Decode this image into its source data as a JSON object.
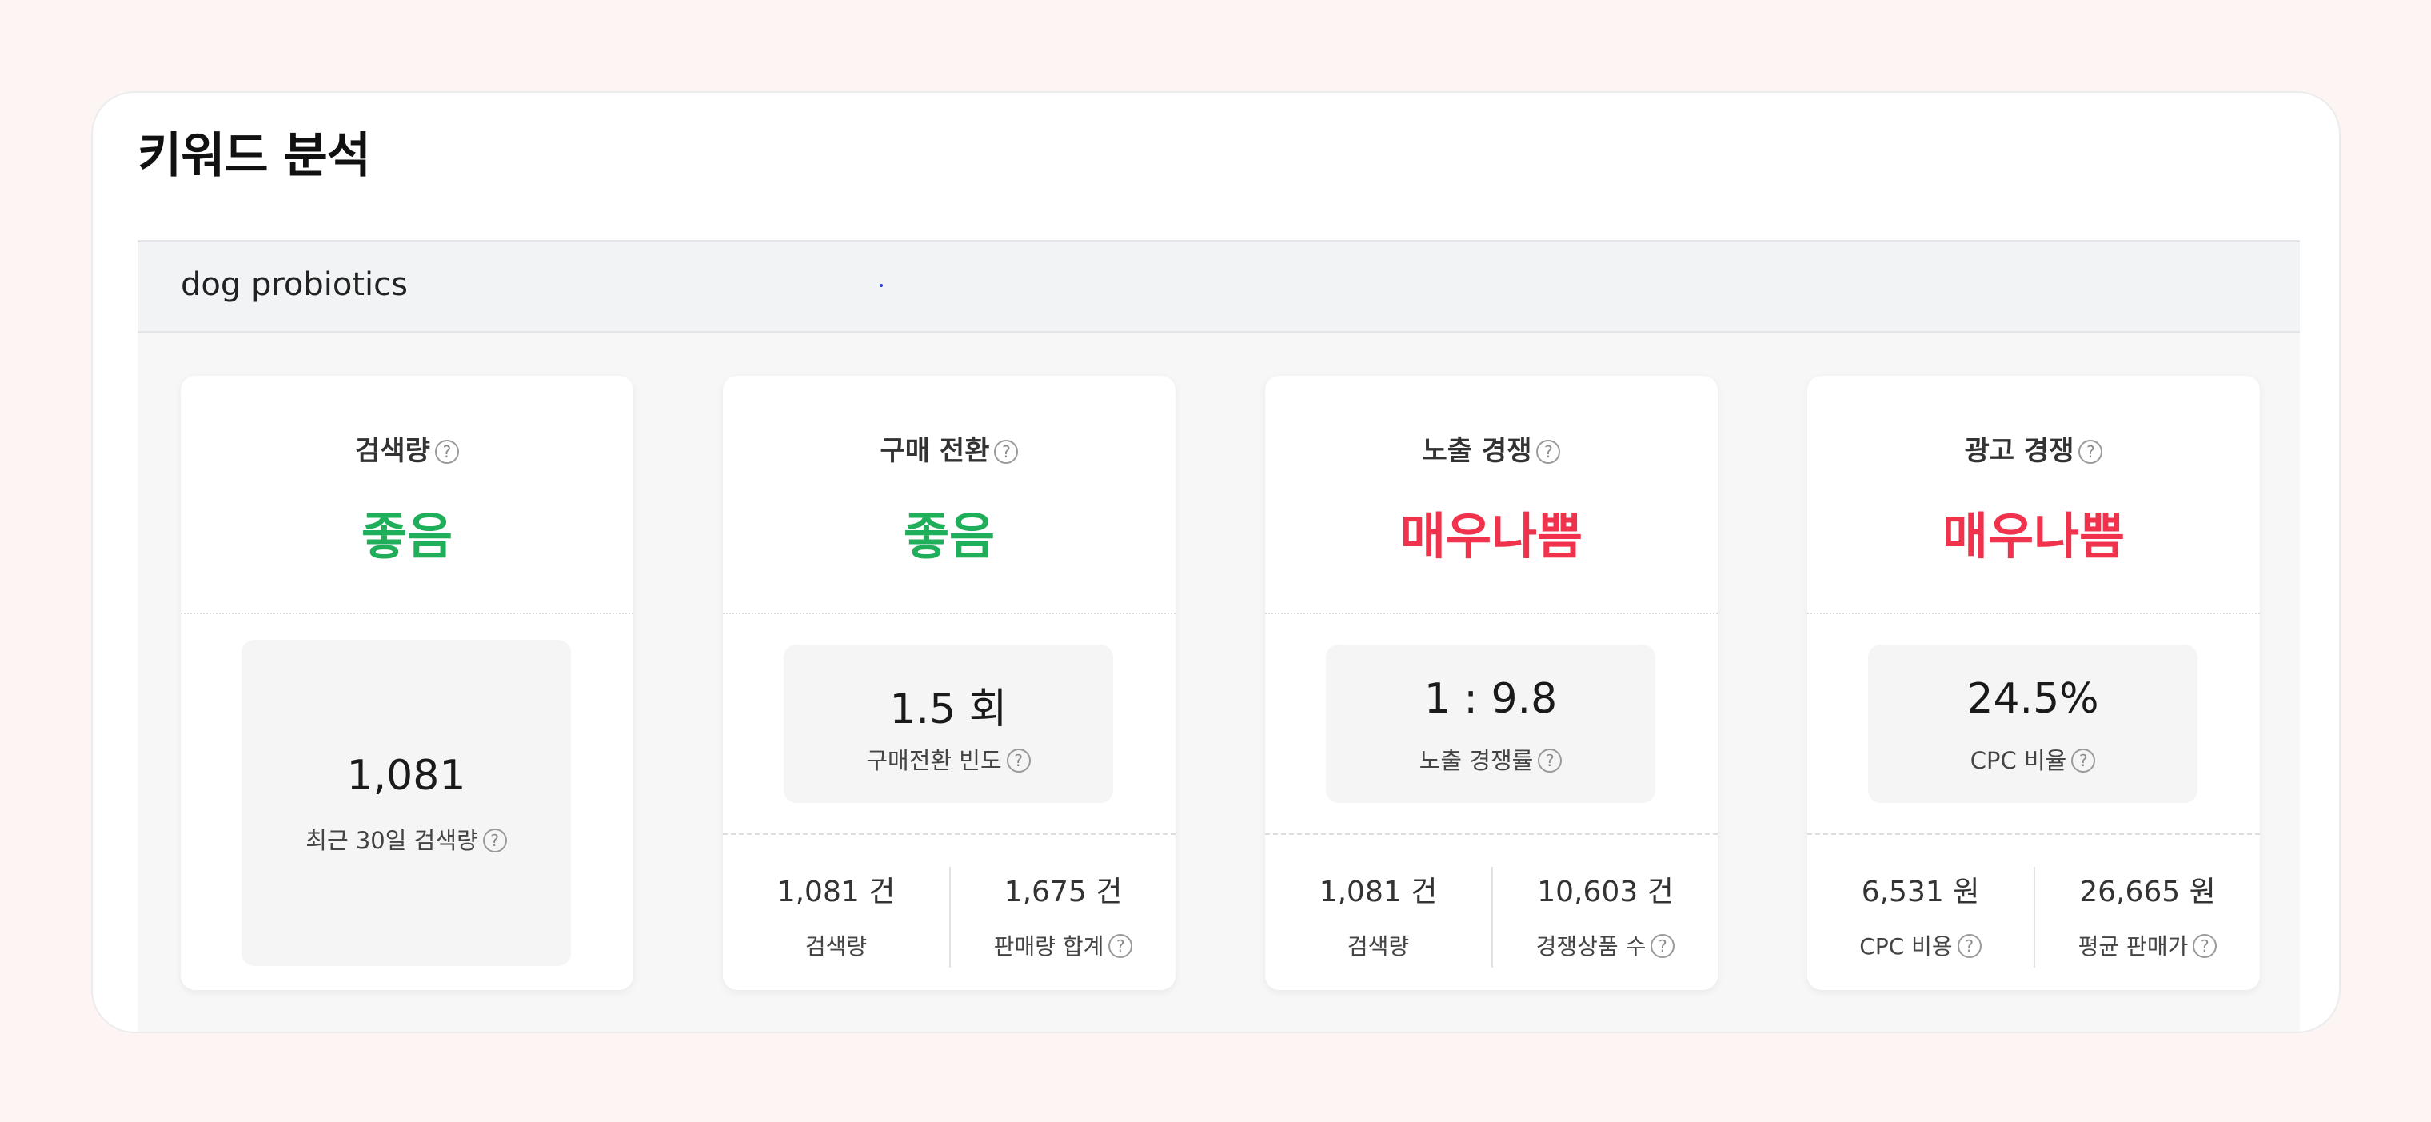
{
  "title": "키워드 분석",
  "keyword": "dog probiotics",
  "help_glyph": "?",
  "colors": {
    "good": "#1fae5a",
    "bad": "#f0324d"
  },
  "cards": [
    {
      "label": "검색량",
      "status": "좋음",
      "status_type": "good",
      "metric_value": "1,081",
      "metric_caption": "최근 30일 검색량"
    },
    {
      "label": "구매 전환",
      "status": "좋음",
      "status_type": "good",
      "metric_value": "1.5 회",
      "metric_caption": "구매전환 빈도",
      "foot": [
        {
          "value": "1,081 건",
          "label": "검색량"
        },
        {
          "value": "1,675 건",
          "label": "판매량 합계"
        }
      ]
    },
    {
      "label": "노출 경쟁",
      "status": "매우나쁨",
      "status_type": "bad",
      "metric_value": "1 : 9.8",
      "metric_caption": "노출 경쟁률",
      "foot": [
        {
          "value": "1,081 건",
          "label": "검색량"
        },
        {
          "value": "10,603 건",
          "label": "경쟁상품 수"
        }
      ]
    },
    {
      "label": "광고 경쟁",
      "status": "매우나쁨",
      "status_type": "bad",
      "metric_value": "24.5%",
      "metric_caption": "CPC 비율",
      "foot": [
        {
          "value": "6,531 원",
          "label": "CPC 비용"
        },
        {
          "value": "26,665 원",
          "label": "평균 판매가"
        }
      ]
    }
  ]
}
